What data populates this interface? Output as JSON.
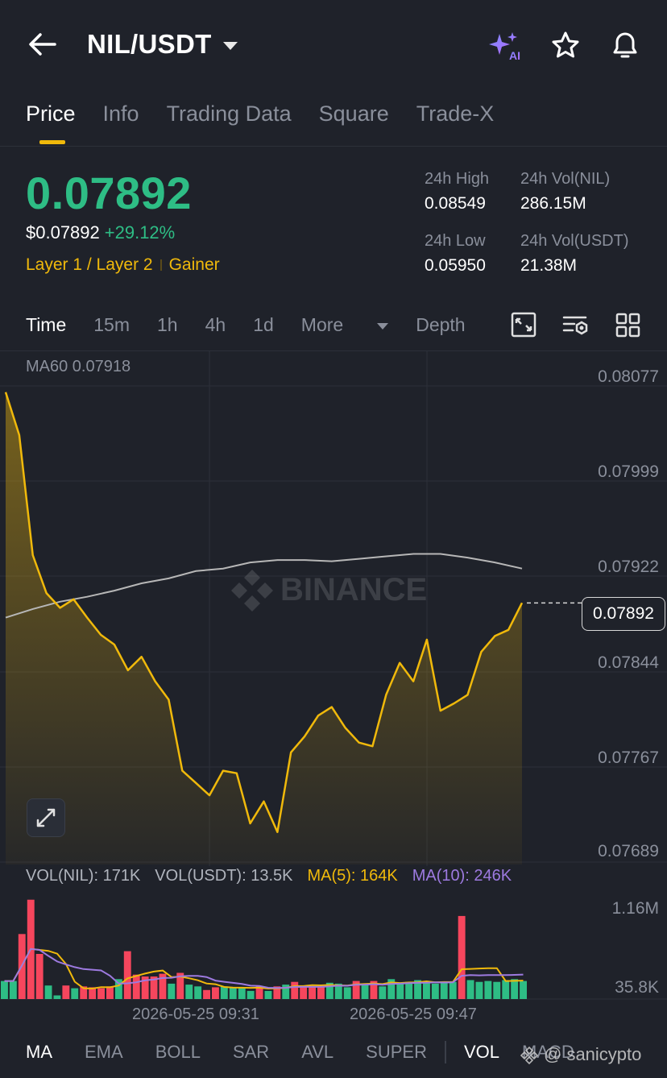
{
  "header": {
    "pair": "NIL/USDT"
  },
  "tabs": [
    {
      "label": "Price",
      "active": true
    },
    {
      "label": "Info",
      "active": false
    },
    {
      "label": "Trading Data",
      "active": false
    },
    {
      "label": "Square",
      "active": false
    },
    {
      "label": "Trade-X",
      "active": false
    }
  ],
  "ticker": {
    "last_price": "0.07892",
    "usd_price": "$0.07892",
    "change": "+29.12%",
    "tag1": "Layer 1 / Layer 2",
    "tag2": "Gainer",
    "high_label": "24h High",
    "high_value": "0.08549",
    "vol_nil_label": "24h Vol(NIL)",
    "vol_nil_value": "286.15M",
    "low_label": "24h Low",
    "low_value": "0.05950",
    "vol_usdt_label": "24h Vol(USDT)",
    "vol_usdt_value": "21.38M"
  },
  "timebar": {
    "time": "Time",
    "m15": "15m",
    "h1": "1h",
    "h4": "4h",
    "d1": "1d",
    "more": "More",
    "depth": "Depth"
  },
  "chart": {
    "ma60_label": "MA60 0.07918",
    "current_price": "0.07892",
    "watermark": "BINANCE",
    "yticks": [
      "0.08077",
      "0.07999",
      "0.07922",
      "0.07844",
      "0.07767",
      "0.07689"
    ],
    "xticks": [
      "2026-05-25 09:31",
      "2026-05-25 09:47"
    ],
    "vol_yticks": [
      "1.16M",
      "35.8K"
    ]
  },
  "volume": {
    "vol_nil": "VOL(NIL): 171K",
    "vol_usdt": "VOL(USDT): 13.5K",
    "ma5": "MA(5): 164K",
    "ma10": "MA(10): 246K"
  },
  "bottom": {
    "ma": "MA",
    "ema": "EMA",
    "boll": "BOLL",
    "sar": "SAR",
    "avl": "AVL",
    "super": "SUPER",
    "vol": "VOL",
    "macd": "MACD"
  },
  "overlay_watermark": "@ sanicypto",
  "colors": {
    "up": "#2ebd85",
    "down": "#f6465d",
    "accent": "#f0b90b",
    "ma10": "#9d7ae0",
    "bg": "#1f222a"
  },
  "chart_data": {
    "type": "area",
    "title": "",
    "ylim": [
      0.07689,
      0.08077
    ],
    "price_series": [
      0.08064,
      0.08029,
      0.07931,
      0.079,
      0.07888,
      0.07895,
      0.0788,
      0.07866,
      0.07858,
      0.07837,
      0.07848,
      0.07828,
      0.07813,
      0.07755,
      0.07745,
      0.07735,
      0.07755,
      0.07753,
      0.07712,
      0.0773,
      0.07705,
      0.0777,
      0.07783,
      0.078,
      0.07807,
      0.0779,
      0.07778,
      0.07775,
      0.07817,
      0.07843,
      0.07828,
      0.07862,
      0.07804,
      0.0781,
      0.07817,
      0.07852,
      0.07865,
      0.0787,
      0.07892
    ],
    "ma60_series": [
      0.0788,
      0.07887,
      0.07893,
      0.07897,
      0.07902,
      0.07908,
      0.07912,
      0.07918,
      0.0792,
      0.07925,
      0.07927,
      0.07927,
      0.07926,
      0.07928,
      0.0793,
      0.07932,
      0.07932,
      0.07929,
      0.07925,
      0.0792
    ],
    "volume": {
      "values": [
        0.2,
        0.2,
        0.72,
        1.1,
        0.5,
        0.15,
        0.04,
        0.15,
        0.12,
        0.14,
        0.13,
        0.12,
        0.14,
        0.22,
        0.53,
        0.27,
        0.25,
        0.25,
        0.28,
        0.17,
        0.29,
        0.16,
        0.14,
        0.1,
        0.13,
        0.14,
        0.13,
        0.13,
        0.09,
        0.14,
        0.09,
        0.14,
        0.16,
        0.19,
        0.14,
        0.14,
        0.13,
        0.18,
        0.17,
        0.13,
        0.2,
        0.16,
        0.2,
        0.14,
        0.22,
        0.17,
        0.19,
        0.21,
        0.19,
        0.17,
        0.18,
        0.19,
        0.92,
        0.21,
        0.19,
        0.2,
        0.19,
        0.21,
        0.22,
        0.2
      ],
      "direction": [
        "up",
        "up",
        "down",
        "down",
        "down",
        "up",
        "up",
        "down",
        "up",
        "down",
        "down",
        "down",
        "down",
        "up",
        "down",
        "down",
        "down",
        "down",
        "down",
        "up",
        "down",
        "up",
        "up",
        "down",
        "down",
        "up",
        "up",
        "up",
        "up",
        "down",
        "up",
        "down",
        "up",
        "down",
        "down",
        "down",
        "down",
        "up",
        "up",
        "up",
        "down",
        "up",
        "down",
        "up",
        "up",
        "up",
        "up",
        "up",
        "up",
        "up",
        "up",
        "up",
        "down",
        "up",
        "up",
        "up",
        "up",
        "up",
        "up",
        "up"
      ],
      "ylim": [
        0.0358,
        1.16
      ]
    }
  }
}
